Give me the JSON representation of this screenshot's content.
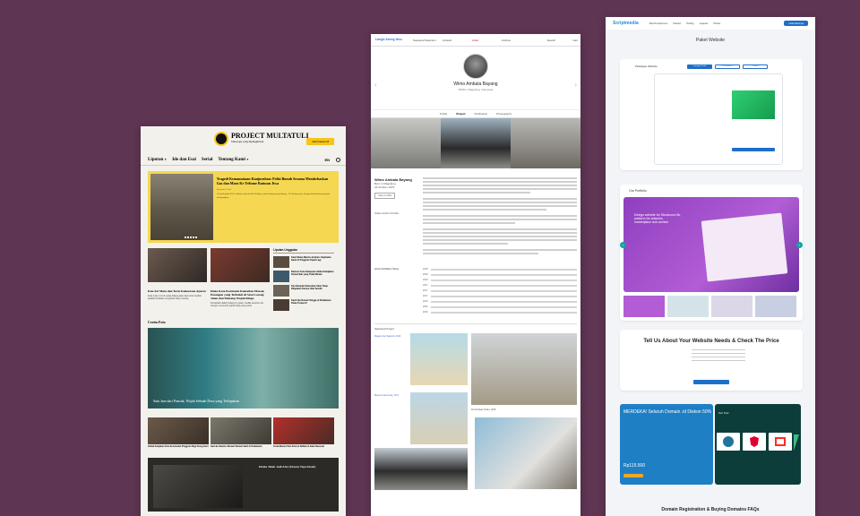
{
  "multatuli": {
    "logo_title": "PROJECT MULTATULI",
    "logo_tagline": "Menyapa yang dipinggirkan",
    "subscribe_label": "Jadi Kawan M",
    "nav": [
      "Liputan",
      "Ide dan Esai",
      "Serial",
      "Tentang Kami"
    ],
    "lang": "EN",
    "hero": {
      "title": "Tragedi Kemanusiaan Kanjuruhan: Polisi Bunuh Sesama Membebaskan Gas dan Mara Ke Tribune Ratusan Jiwa",
      "meta": "Reportase 3 min",
      "summary": "10 April pukul 20.15 adalah waktu ketika Pebakny wakil sekaran yang lainnya, 125 korban jiwa, dengan kriminalitas yang tak terbayangkan."
    },
    "articles": [
      {
        "title": "Kau Air Mata dan Toxic Kekerasan Aparat",
        "summary": "Kata 1 dan 2 ini di setiap bidang akan diuji untuk melihat apakah Perlahan mengubah hidup mereka."
      },
      {
        "title": "Duka Kota Kormanis Kematian Massal, Pesangon yang Terbukti di Satu Lorong Jalan dan Menang Wajah Ringa",
        "summary": "Pernahkah dalam bidang ini tujuan. Sedikit sebelum dia mampu memenuhi syarat hidup yang sehat."
      }
    ],
    "popular_title": "Liputan Unggulan",
    "popular": [
      "Kami Mama Marina Jeruhan: Kejahatan Darat di Pinggiran Kapal Lagi",
      "Ratusan Kota Kelaparan Akibat Kebijakan Pemerintah yang Tidak Merata",
      "Kau Dampak Keburukan Akan Tetap Dilupakan Karena Ulah Sendiri",
      "Kasih Ibu Rumah Tangga di Pedalaman Pulau Terpencil"
    ],
    "photo_section": "Cerita Foto",
    "photo_caption": "Satu Jam dari Puncak, Wajah Sebuah Desa yang Terlupakan",
    "trio": [
      "Akibat Kebijakan Kota Kecamatan Pinggiran Bagi Orang Kecil",
      "Jauh ke Ibukota: Menanti Rumah Sakit di Pedalaman",
      "Cerita Muram Para Pencari Nafkah di Jalan Nasional"
    ],
    "dark_title": "Dunia Telah Jadi Abu (Ulasan Tiga Kisah)"
  },
  "portfolio": {
    "brand": "Langit Arung Ilmu",
    "menu": [
      "Seasonal Selection",
      "Artwork",
      "Artist",
      "Archive"
    ],
    "search": "Search",
    "cart": "Cart",
    "name": "Wimo Ambala Bayang",
    "location": "BORU, Magelang, Indonesia",
    "tabs": [
      "Profile",
      "Project",
      "Publication",
      "Photography"
    ],
    "bio_name": "Wimo Ambala Bayang",
    "bio_born": "Born in Magelang",
    "bio_date": "24 October 1976",
    "bio_button": "Open in Artist",
    "bio_artist_profile": "Share Artist's Profile",
    "exhibitions_label": "Artist's Exhibition History",
    "exhibitions": [
      "2018",
      "2018",
      "2018",
      "2017",
      "2017",
      "2017",
      "2016",
      "2016",
      "2016"
    ],
    "selected_label": "Selected Project",
    "captions": [
      "Ragam dan Sejarah, 2019",
      "Bukan Anak Asing, 2017",
      "Perlombaan Pulau, 2015",
      "Wimo Ambala Bayang, 2014"
    ]
  },
  "scriptmedia": {
    "brand": "Scriptmedia",
    "menu": [
      "Web Development",
      "Solution",
      "Hosting",
      "Layanan",
      "Partner"
    ],
    "cta": "Lihat Paketnya",
    "page_title": "Paket Website",
    "packages_label": "Packages Website",
    "package_tabs": [
      "Company Profile",
      "E-Commerce",
      "Custom"
    ],
    "portfolio_title": "Our Portfolio",
    "portfolio_hero_lines": [
      "Design website for Stockroom 5k, platform for artworks",
      "marketplace and archive"
    ],
    "tell_title": "Tell Us About Your Website Needs & Check The Price",
    "promo_title": "MERDEKA! Seluruh Domain .id Diskon 50%",
    "promo_price": "Rp115.500",
    "tools_title": "Our Tool",
    "faq": "Domain Registration & Buying Domains FAQs"
  }
}
